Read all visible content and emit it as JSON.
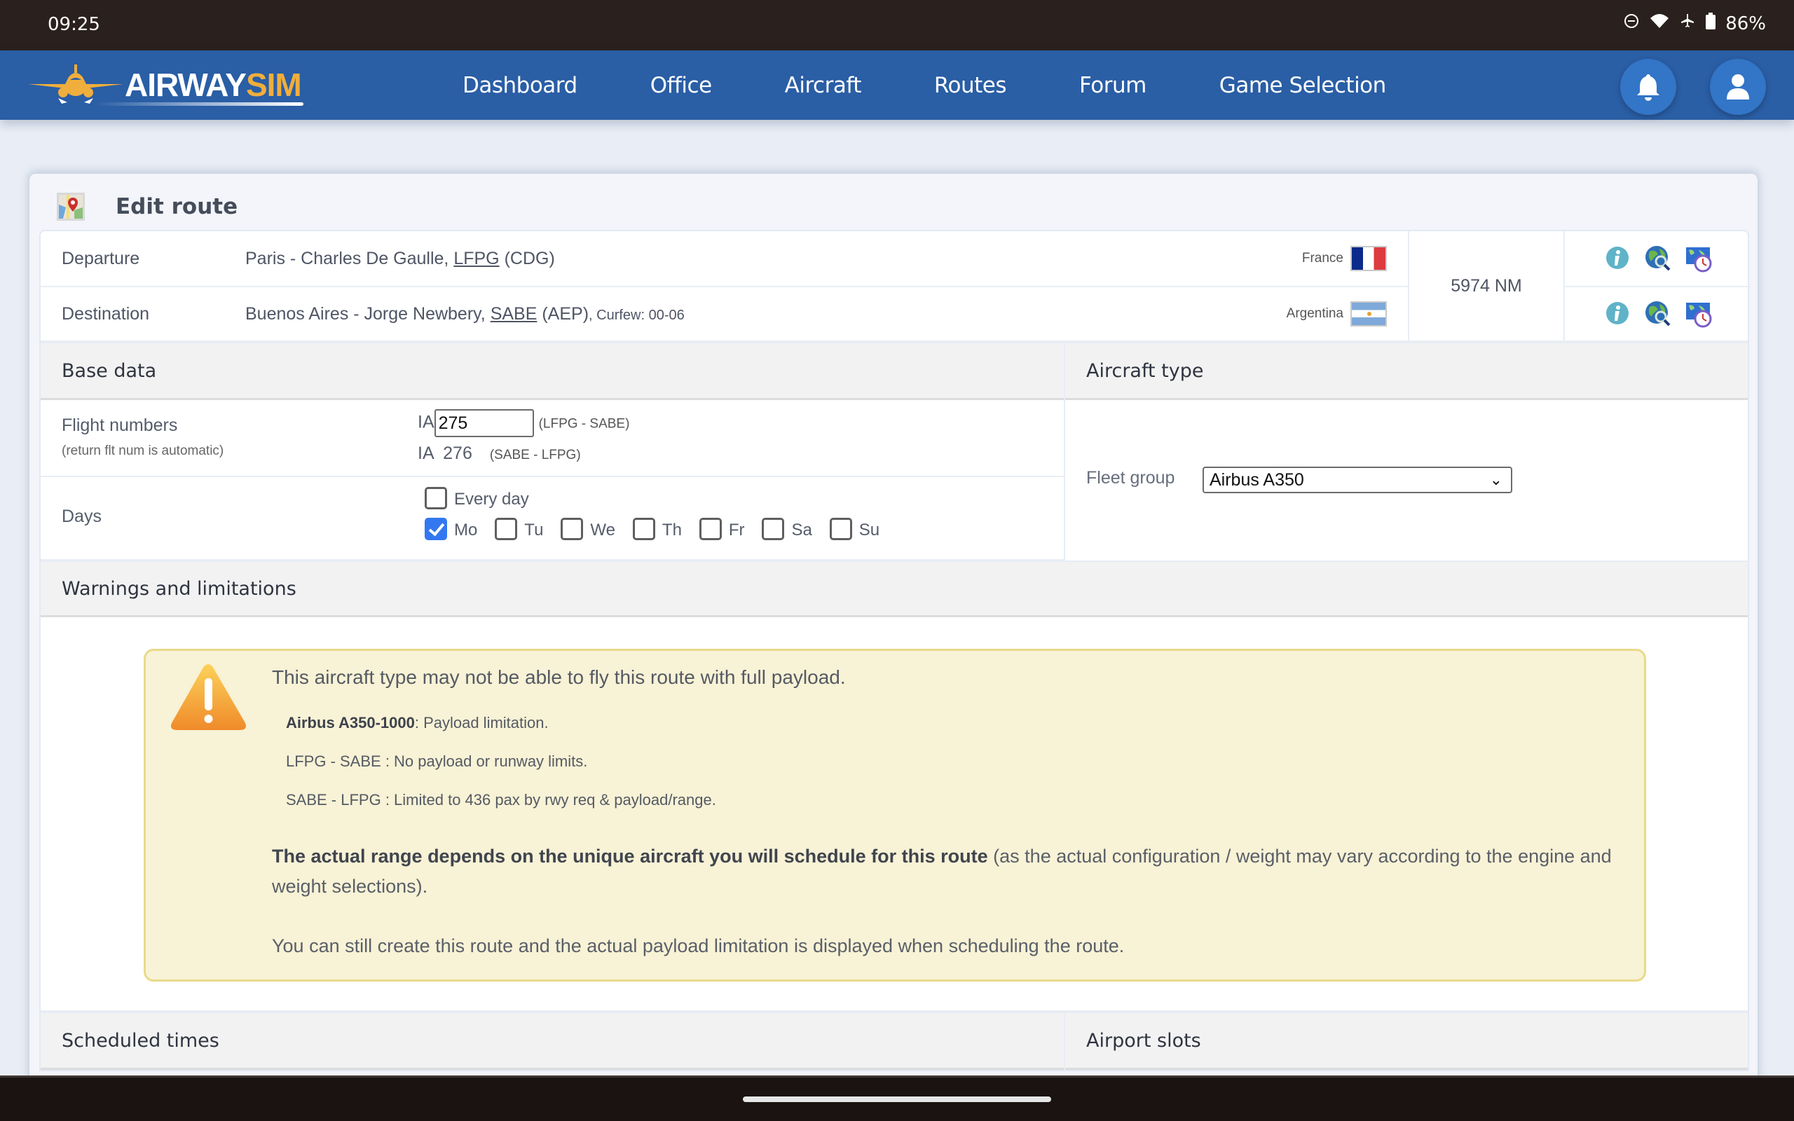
{
  "status_bar": {
    "time": "09:25",
    "battery": "86%",
    "icons": [
      "dnd-icon",
      "wifi-icon",
      "airplane-mode-icon",
      "battery-icon"
    ]
  },
  "nav": {
    "logo_text_1": "AIRWAY",
    "logo_text_2": "SIM",
    "items": [
      {
        "label": "Dashboard"
      },
      {
        "label": "Office"
      },
      {
        "label": "Aircraft"
      },
      {
        "label": "Routes"
      },
      {
        "label": "Forum"
      },
      {
        "label": "Game Selection"
      }
    ],
    "notification_icon": "bell-icon",
    "profile_icon": "user-icon"
  },
  "page": {
    "title": "Edit route",
    "title_icon": "map-icon"
  },
  "route": {
    "departure": {
      "label": "Departure",
      "city_airport": "Paris - Charles De Gaulle, ",
      "icao": "LFPG",
      "iata": " (CDG)",
      "country": "France",
      "flag": "flag-france"
    },
    "destination": {
      "label": "Destination",
      "city_airport": "Buenos Aires - Jorge Newbery, ",
      "icao": "SABE",
      "iata": " (AEP)",
      "curfew": ", Curfew: 00-06",
      "country": "Argentina",
      "flag": "flag-argentina"
    },
    "distance": "5974 NM",
    "row_icons": [
      "info-icon",
      "globe-search-icon",
      "world-clock-icon"
    ]
  },
  "base_data": {
    "header": "Base data",
    "flight_numbers": {
      "label": "Flight numbers",
      "sublabel": "(return flt num is automatic)",
      "prefix": "IA",
      "outbound_value": "275",
      "outbound_route": "(LFPG - SABE)",
      "return_value": "IA  276",
      "return_route": "(SABE - LFPG)"
    },
    "days": {
      "label": "Days",
      "every_day_label": "Every day",
      "every_day_checked": false,
      "options": [
        {
          "label": "Mo",
          "checked": true
        },
        {
          "label": "Tu",
          "checked": false
        },
        {
          "label": "We",
          "checked": false
        },
        {
          "label": "Th",
          "checked": false
        },
        {
          "label": "Fr",
          "checked": false
        },
        {
          "label": "Sa",
          "checked": false
        },
        {
          "label": "Su",
          "checked": false
        }
      ]
    }
  },
  "aircraft_type": {
    "header": "Aircraft type",
    "fleet_group_label": "Fleet group",
    "fleet_group_value": "Airbus A350"
  },
  "warnings": {
    "header": "Warnings and limitations",
    "main": "This aircraft type may not be able to fly this route with full payload.",
    "aircraft_name": "Airbus A350-1000",
    "aircraft_limit": ": Payload limitation.",
    "leg1": "LFPG - SABE : No payload or runway limits.",
    "leg2": "SABE - LFPG : Limited to 436 pax by rwy req & payload/range.",
    "range_bold": "The actual range depends on the unique aircraft you will schedule for this route",
    "range_rest": " (as the actual configuration / weight may vary according to the engine and weight selections).",
    "still_create": "You can still create this route and the actual payload limitation is displayed when scheduling the route."
  },
  "lower_sections": {
    "scheduled_times": "Scheduled times",
    "airport_slots": "Airport slots"
  },
  "colors": {
    "nav_bg": "#2a5ea5",
    "logo_accent": "#f0ae3c",
    "warning_bg": "#f8f2d6",
    "warning_border": "#e9da8a",
    "checkbox_checked": "#3378f0"
  }
}
